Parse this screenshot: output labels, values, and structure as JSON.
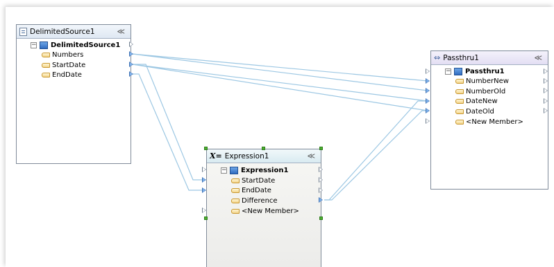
{
  "nodes": {
    "source": {
      "title": "DelimitedSource1",
      "entity": "DelimitedSource1",
      "fields": [
        "Numbers",
        "StartDate",
        "EndDate"
      ]
    },
    "passthru": {
      "title": "Passthru1",
      "entity": "Passthru1",
      "fields": [
        "NumberNew",
        "NumberOld",
        "DateNew",
        "DateOld",
        "<New Member>"
      ]
    },
    "expression": {
      "title": "Expression1",
      "icon_text": "X=",
      "entity": "Expression1",
      "fields": [
        "StartDate",
        "EndDate",
        "Difference",
        "<New Member>"
      ]
    }
  },
  "collapse_glyph": "≪",
  "colors": {
    "wire": "#9cc7e3",
    "handle": "#4caf2f"
  }
}
